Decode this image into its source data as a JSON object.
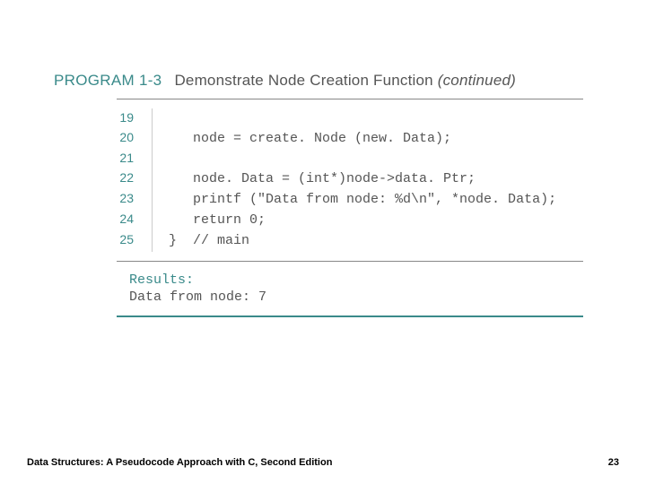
{
  "header": {
    "program_label": "PROGRAM 1-3",
    "title_main": "Demonstrate Node Creation Function ",
    "title_continued": "(continued)"
  },
  "code": {
    "lines": [
      {
        "n": "19",
        "text": ""
      },
      {
        "n": "20",
        "text": "   node = create. Node (new. Data);"
      },
      {
        "n": "21",
        "text": ""
      },
      {
        "n": "22",
        "text": "   node. Data = (int*)node->data. Ptr;"
      },
      {
        "n": "23",
        "text": "   printf (\"Data from node: %d\\n\", *node. Data);"
      },
      {
        "n": "24",
        "text": "   return 0;"
      },
      {
        "n": "25",
        "text": "}  // main"
      }
    ]
  },
  "results": {
    "label": "Results:",
    "output": "Data from node: 7"
  },
  "footer": {
    "book": "Data Structures: A Pseudocode Approach with C, Second Edition",
    "page": "23"
  }
}
